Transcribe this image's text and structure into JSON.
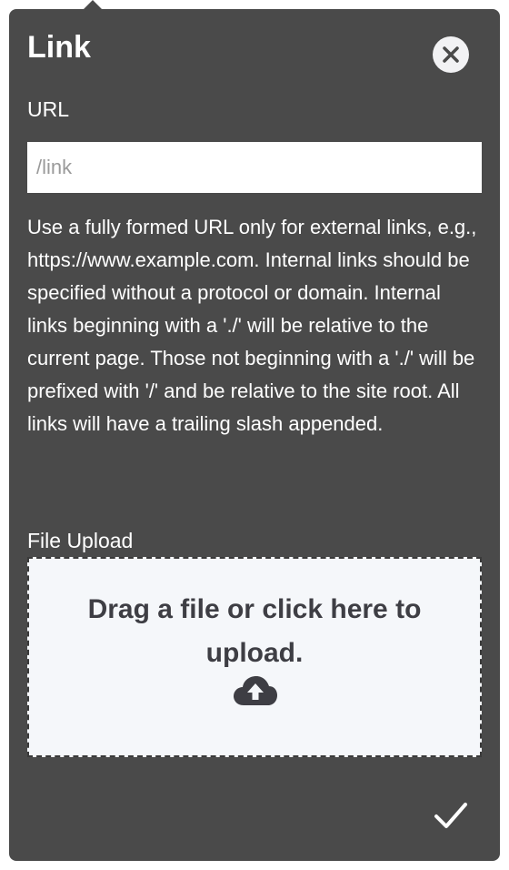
{
  "popover": {
    "title": "Link",
    "url": {
      "label": "URL",
      "placeholder": "/link",
      "value": ""
    },
    "help_text": "Use a fully formed URL only for external links, e.g., https://www.example.com. Internal links should be specified without a protocol or domain. Internal links beginning with a './' will be relative to the current page. Those not beginning with a './' will be prefixed with '/' and be relative to the site root. All links will have a trailing slash appended.",
    "file_upload": {
      "label": "File Upload",
      "dropzone_text": "Drag a file or click here to upload.",
      "icon": "cloud-upload-icon"
    },
    "close_icon": "close-icon",
    "confirm_icon": "checkmark-icon"
  },
  "colors": {
    "panel": "#4a4a4a",
    "dropzone_bg": "#f5f7fa",
    "close_bg": "#f2f2f4"
  }
}
